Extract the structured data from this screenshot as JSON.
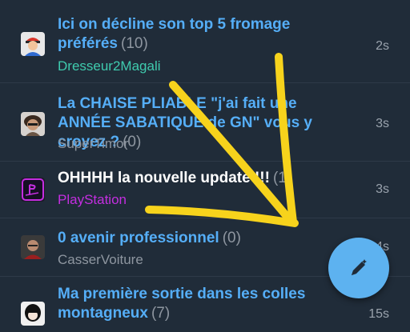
{
  "topics": [
    {
      "title": "Ici on décline son top 5 fromage préférés",
      "count": "(10)",
      "author": "Dresseur2Magali",
      "age": "2s",
      "author_color": "#3fcbae"
    },
    {
      "title": "La CHAISE PLIABLE \"j'ai fait une ANNÉE SABATIQUE de GN\" vous y croyez ?",
      "count": "(0)",
      "author": "SuperTimor",
      "age": "3s",
      "author_color": "#8e96a0"
    },
    {
      "title": "OHHHH la nouvelle update !!!",
      "count": "(1)",
      "author": "PlayStation",
      "age": "3s",
      "author_color": "#c42ee0"
    },
    {
      "title": "0 avenir professionnel",
      "count": "(0)",
      "author": "CasserVoiture",
      "age": "4s",
      "author_color": "#8e96a0"
    },
    {
      "title": "Ma première sortie dans les colles montagneux",
      "count": "(7)",
      "author": "",
      "age": "15s",
      "author_color": "#8e96a0"
    }
  ],
  "fab": {
    "icon": "edit-pen-icon"
  },
  "colors": {
    "background": "#202c39",
    "link": "#55aef7",
    "fab": "#5db2f0",
    "overlay_arrow": "#f7d31c"
  }
}
